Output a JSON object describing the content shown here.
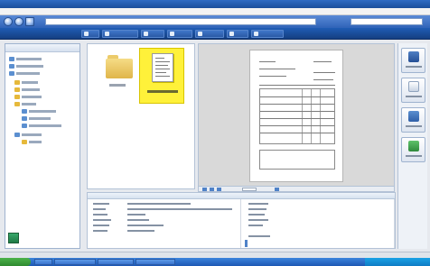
{
  "window": {
    "title": ""
  },
  "menubar": {
    "items": []
  },
  "addressbar": {
    "path": "",
    "search_placeholder": ""
  },
  "toolbar": {
    "items": []
  },
  "sidebar": {
    "header": "",
    "items": []
  },
  "files": {
    "folder_label": "",
    "document_label": ""
  },
  "preview": {
    "page_number": ""
  },
  "details": {
    "header_left": "",
    "header_right": "",
    "rows": []
  },
  "actions": {
    "items": []
  },
  "statusbar": {
    "text": ""
  },
  "taskbar": {
    "start_label": "",
    "tasks": [],
    "clock": ""
  },
  "colors": {
    "toolbar": "#1f5cb4",
    "selection": "#fff13a",
    "titlebar": "#2f6cc4"
  },
  "icons": {
    "sidebar": "tree-folder-icon",
    "folder": "folder-icon",
    "document": "document-icon",
    "actions": [
      "scan-icon",
      "edit-icon",
      "share-icon",
      "export-icon"
    ]
  }
}
